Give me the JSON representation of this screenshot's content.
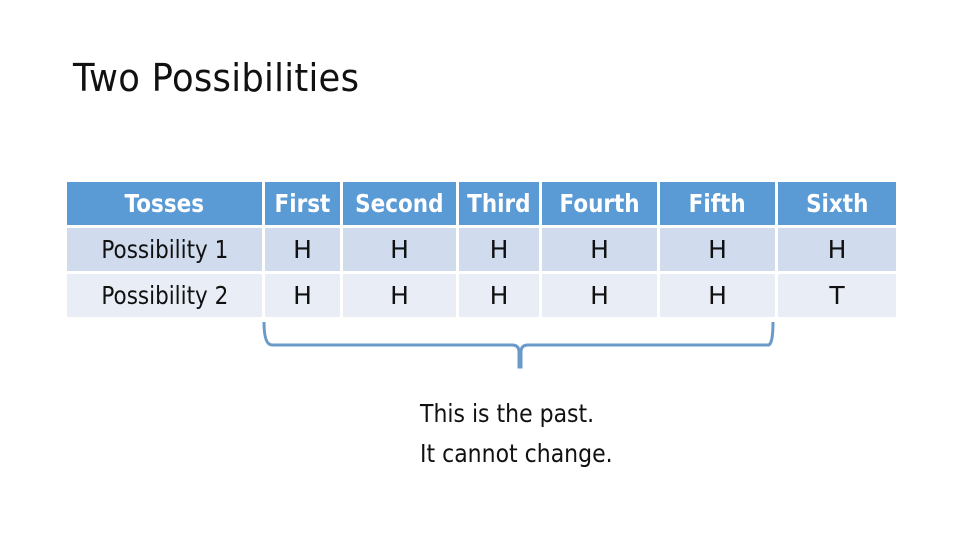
{
  "slide": {
    "title": "Two Possibilities"
  },
  "table": {
    "headers": [
      "Tosses",
      "First",
      "Second",
      "Third",
      "Fourth",
      "Fifth",
      "Sixth"
    ],
    "rows": [
      {
        "label": "Possibility 1",
        "cells": [
          "H",
          "H",
          "H",
          "H",
          "H",
          "H"
        ]
      },
      {
        "label": "Possibility 2",
        "cells": [
          "H",
          "H",
          "H",
          "H",
          "H",
          "T"
        ]
      }
    ]
  },
  "annotation": {
    "line1": "This is the past.",
    "line2": "It cannot change."
  },
  "colors": {
    "header_bg": "#5b9bd5",
    "row1_bg": "#d0dbee",
    "row2_bg": "#e9edf6",
    "brace": "#6a9bc8"
  }
}
